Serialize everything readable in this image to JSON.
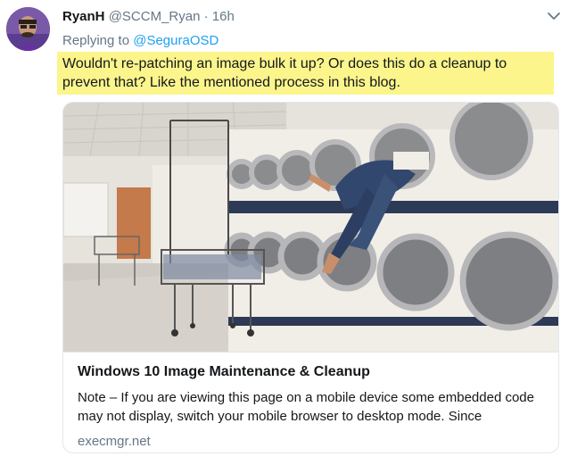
{
  "tweet": {
    "author_name": "RyanH",
    "author_handle": "@SCCM_Ryan",
    "separator": "·",
    "timestamp": "16h",
    "reply_prefix": "Replying to",
    "reply_to": "@SeguraOSD",
    "text": "Wouldn't re-patching an image bulk it up? Or does this do a cleanup to prevent that? Like the mentioned process in this blog.",
    "highlight_color": "#fbf58c"
  },
  "card": {
    "image_icon": "laundromat-photo",
    "title": "Windows 10 Image Maintenance & Cleanup",
    "description": "Note – If you are viewing this page on a mobile device some embedded code may not display, switch your mobile browser to desktop mode.  Since",
    "domain": "execmgr.net"
  },
  "colors": {
    "link": "#1da1f2",
    "muted": "#657786",
    "text": "#14171a"
  }
}
